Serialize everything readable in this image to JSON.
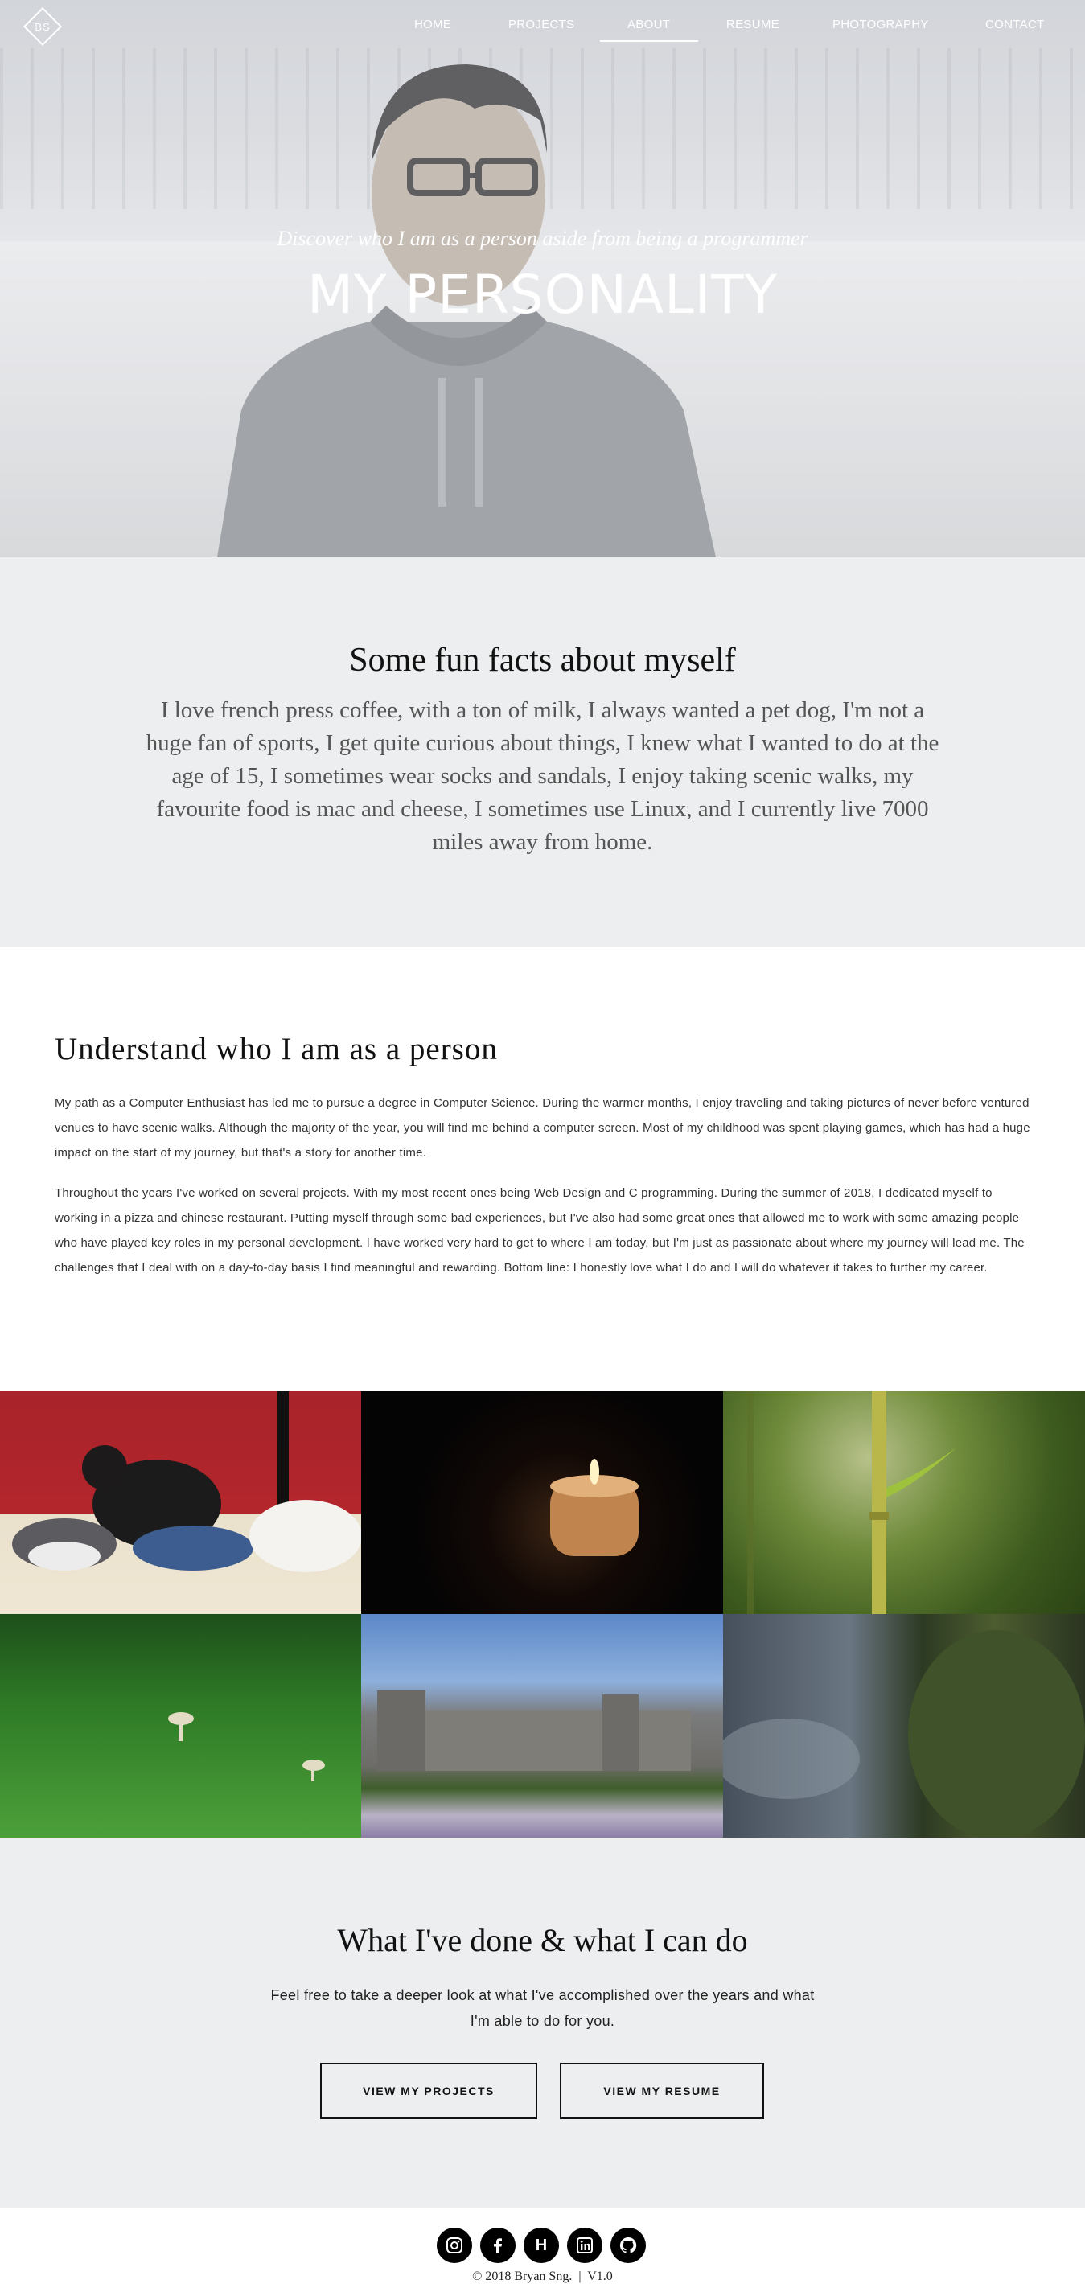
{
  "header": {
    "logo_text": "BS",
    "nav": [
      {
        "label": "HOME"
      },
      {
        "label": "PROJECTS"
      },
      {
        "label": "ABOUT",
        "active": true
      },
      {
        "label": "RESUME"
      },
      {
        "label": "PHOTOGRAPHY"
      },
      {
        "label": "CONTACT"
      }
    ]
  },
  "hero": {
    "subtitle": "Discover who I am as a person aside from being a programmer",
    "title": "MY PERSONALITY"
  },
  "facts": {
    "heading": "Some fun facts about myself",
    "text": "I love french press coffee, with a ton of milk, I always wanted a pet dog, I'm not a huge fan of sports, I get quite curious about things, I knew what I wanted to do at the age of 15, I sometimes wear socks and sandals, I enjoy taking scenic walks, my favourite food is mac and cheese, I sometimes use Linux, and I currently live 7000 miles away from home."
  },
  "understand": {
    "heading": "Understand who I am as a person",
    "paragraph1": "My path as a Computer Enthusiast has led me to pursue a degree in Computer Science. During the warmer months, I enjoy traveling and taking pictures of never before ventured venues to have scenic walks. Although the majority of the year, you will find me behind a computer screen. Most of my childhood was spent playing games, which has had a huge impact on the start of my journey, but that's a story for another time.",
    "paragraph2": "Throughout the years I've worked on several projects. With my most recent ones being Web Design and C programming. During the summer of 2018, I dedicated myself to working in a pizza and chinese restaurant. Putting myself through some bad experiences, but I've also had some great ones that allowed me to work with some amazing people who have played key roles in my personal development. I have worked very hard to get to where I am today, but I'm just as passionate about where my journey will lead me. The challenges that I deal with on a day-to-day basis I find meaningful and rewarding. Bottom line: I honestly love what I do and I will do whatever it takes to further my career."
  },
  "gallery": {
    "photos": [
      {
        "name": "dogs-photo"
      },
      {
        "name": "candle-photo"
      },
      {
        "name": "bamboo-photo"
      },
      {
        "name": "grass-mushroom-photo"
      },
      {
        "name": "castle-photo"
      },
      {
        "name": "moss-tree-photo"
      }
    ]
  },
  "done": {
    "heading": "What I've done & what I can do",
    "text": "Feel free to take a deeper look at what I've accomplished over the years and what I'm able to do for you.",
    "projects_button": "VIEW MY PROJECTS",
    "resume_button": "VIEW MY RESUME"
  },
  "footer": {
    "social": [
      {
        "icon": "instagram-icon"
      },
      {
        "icon": "facebook-icon"
      },
      {
        "icon": "hackerrank-icon",
        "glyph": "H"
      },
      {
        "icon": "linkedin-icon"
      },
      {
        "icon": "github-icon"
      }
    ],
    "copyright": "© 2018 Bryan Sng.",
    "version": "V1.0"
  },
  "colors": {
    "section_bg": "#edeeef",
    "text": "#222222",
    "button_border": "#111111"
  }
}
